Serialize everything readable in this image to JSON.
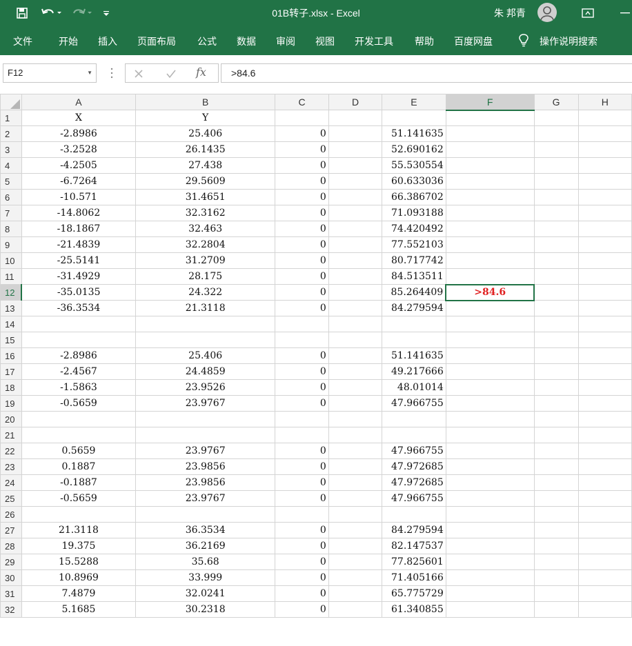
{
  "window": {
    "title": "01B转子.xlsx  -  Excel",
    "user": "朱 邦青"
  },
  "quick_access": [
    "save-icon",
    "undo-icon",
    "redo-icon",
    "customize-icon"
  ],
  "ribbon_tabs": [
    "文件",
    "开始",
    "插入",
    "页面布局",
    "公式",
    "数据",
    "审阅",
    "视图",
    "开发工具",
    "帮助",
    "百度网盘",
    "操作说明搜索"
  ],
  "name_box": "F12",
  "formula": ">84.6",
  "active_cell": {
    "ref": "F12",
    "value": ">84.6",
    "display": ">84.6"
  },
  "columns": [
    "A",
    "B",
    "C",
    "D",
    "E",
    "F",
    "G",
    "H"
  ],
  "rows": [
    {
      "n": "1",
      "cells": [
        "X",
        "Y",
        "",
        "",
        "",
        "",
        "",
        ""
      ]
    },
    {
      "n": "2",
      "cells": [
        "-2.8986",
        "25.406",
        "0",
        "",
        "51.141635",
        "",
        "",
        ""
      ]
    },
    {
      "n": "3",
      "cells": [
        "-3.2528",
        "26.1435",
        "0",
        "",
        "52.690162",
        "",
        "",
        ""
      ]
    },
    {
      "n": "4",
      "cells": [
        "-4.2505",
        "27.438",
        "0",
        "",
        "55.530554",
        "",
        "",
        ""
      ]
    },
    {
      "n": "5",
      "cells": [
        "-6.7264",
        "29.5609",
        "0",
        "",
        "60.633036",
        "",
        "",
        ""
      ]
    },
    {
      "n": "6",
      "cells": [
        "-10.571",
        "31.4651",
        "0",
        "",
        "66.386702",
        "",
        "",
        ""
      ]
    },
    {
      "n": "7",
      "cells": [
        "-14.8062",
        "32.3162",
        "0",
        "",
        "71.093188",
        "",
        "",
        ""
      ]
    },
    {
      "n": "8",
      "cells": [
        "-18.1867",
        "32.463",
        "0",
        "",
        "74.420492",
        "",
        "",
        ""
      ]
    },
    {
      "n": "9",
      "cells": [
        "-21.4839",
        "32.2804",
        "0",
        "",
        "77.552103",
        "",
        "",
        ""
      ]
    },
    {
      "n": "10",
      "cells": [
        "-25.5141",
        "31.2709",
        "0",
        "",
        "80.717742",
        "",
        "",
        ""
      ]
    },
    {
      "n": "11",
      "cells": [
        "-31.4929",
        "28.175",
        "0",
        "",
        "84.513511",
        "",
        "",
        ""
      ]
    },
    {
      "n": "12",
      "cells": [
        "-35.0135",
        "24.322",
        "0",
        "",
        "85.264409",
        ">84.6",
        "",
        ""
      ]
    },
    {
      "n": "13",
      "cells": [
        "-36.3534",
        "21.3118",
        "0",
        "",
        "84.279594",
        "",
        "",
        ""
      ]
    },
    {
      "n": "14",
      "cells": [
        "",
        "",
        "",
        "",
        "",
        "",
        "",
        ""
      ]
    },
    {
      "n": "15",
      "cells": [
        "",
        "",
        "",
        "",
        "",
        "",
        "",
        ""
      ]
    },
    {
      "n": "16",
      "cells": [
        "-2.8986",
        "25.406",
        "0",
        "",
        "51.141635",
        "",
        "",
        ""
      ]
    },
    {
      "n": "17",
      "cells": [
        "-2.4567",
        "24.4859",
        "0",
        "",
        "49.217666",
        "",
        "",
        ""
      ]
    },
    {
      "n": "18",
      "cells": [
        "-1.5863",
        "23.9526",
        "0",
        "",
        "48.01014",
        "",
        "",
        ""
      ]
    },
    {
      "n": "19",
      "cells": [
        "-0.5659",
        "23.9767",
        "0",
        "",
        "47.966755",
        "",
        "",
        ""
      ]
    },
    {
      "n": "20",
      "cells": [
        "",
        "",
        "",
        "",
        "",
        "",
        "",
        ""
      ]
    },
    {
      "n": "21",
      "cells": [
        "",
        "",
        "",
        "",
        "",
        "",
        "",
        ""
      ]
    },
    {
      "n": "22",
      "cells": [
        "0.5659",
        "23.9767",
        "0",
        "",
        "47.966755",
        "",
        "",
        ""
      ]
    },
    {
      "n": "23",
      "cells": [
        "0.1887",
        "23.9856",
        "0",
        "",
        "47.972685",
        "",
        "",
        ""
      ]
    },
    {
      "n": "24",
      "cells": [
        "-0.1887",
        "23.9856",
        "0",
        "",
        "47.972685",
        "",
        "",
        ""
      ]
    },
    {
      "n": "25",
      "cells": [
        "-0.5659",
        "23.9767",
        "0",
        "",
        "47.966755",
        "",
        "",
        ""
      ]
    },
    {
      "n": "26",
      "cells": [
        "",
        "",
        "",
        "",
        "",
        "",
        "",
        ""
      ]
    },
    {
      "n": "27",
      "cells": [
        "21.3118",
        "36.3534",
        "0",
        "",
        "84.279594",
        "",
        "",
        ""
      ]
    },
    {
      "n": "28",
      "cells": [
        "19.375",
        "36.2169",
        "0",
        "",
        "82.147537",
        "",
        "",
        ""
      ]
    },
    {
      "n": "29",
      "cells": [
        "15.5288",
        "35.68",
        "0",
        "",
        "77.825601",
        "",
        "",
        ""
      ]
    },
    {
      "n": "30",
      "cells": [
        "10.8969",
        "33.999",
        "0",
        "",
        "71.405166",
        "",
        "",
        ""
      ]
    },
    {
      "n": "31",
      "cells": [
        "7.4879",
        "32.0241",
        "0",
        "",
        "65.775729",
        "",
        "",
        ""
      ]
    },
    {
      "n": "32",
      "cells": [
        "5.1685",
        "30.2318",
        "0",
        "",
        "61.340855",
        "",
        "",
        ""
      ]
    }
  ]
}
